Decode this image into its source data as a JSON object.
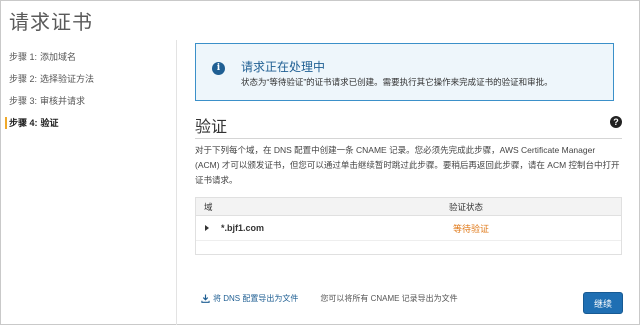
{
  "page": {
    "title": "请求证书"
  },
  "steps": [
    {
      "num": "步骤 1:",
      "label": "添加域名"
    },
    {
      "num": "步骤 2:",
      "label": "选择验证方法"
    },
    {
      "num": "步骤 3:",
      "label": "审核并请求"
    },
    {
      "num": "步骤 4:",
      "label": "验证"
    }
  ],
  "info": {
    "icon": "info-icon",
    "title": "请求正在处理中",
    "text": "状态为“等待验证”的证书请求已创建。需要执行其它操作来完成证书的验证和审批。"
  },
  "section": {
    "title": "验证",
    "description": "对于下列每个域，在 DNS 配置中创建一条 CNAME 记录。您必须先完成此步骤，AWS Certificate Manager (ACM) 才可以颁发证书，但您可以通过单击继续暂时跳过此步骤。要稍后再返回此步骤，请在 ACM 控制台中打开证书请求。"
  },
  "table": {
    "columns": [
      "域",
      "验证状态"
    ],
    "rows": [
      {
        "domain": "*.bjf1.com",
        "status": "等待验证"
      }
    ]
  },
  "export": {
    "link_label": "将 DNS 配置导出为文件",
    "note": "您可以将所有 CNAME 记录导出为文件"
  },
  "buttons": {
    "continue_label": "继续"
  },
  "colors": {
    "accent": "#1f6fb3",
    "pending": "#e07b1c",
    "info_border": "#3b90c9",
    "active_step_marker": "#f0a92a"
  }
}
